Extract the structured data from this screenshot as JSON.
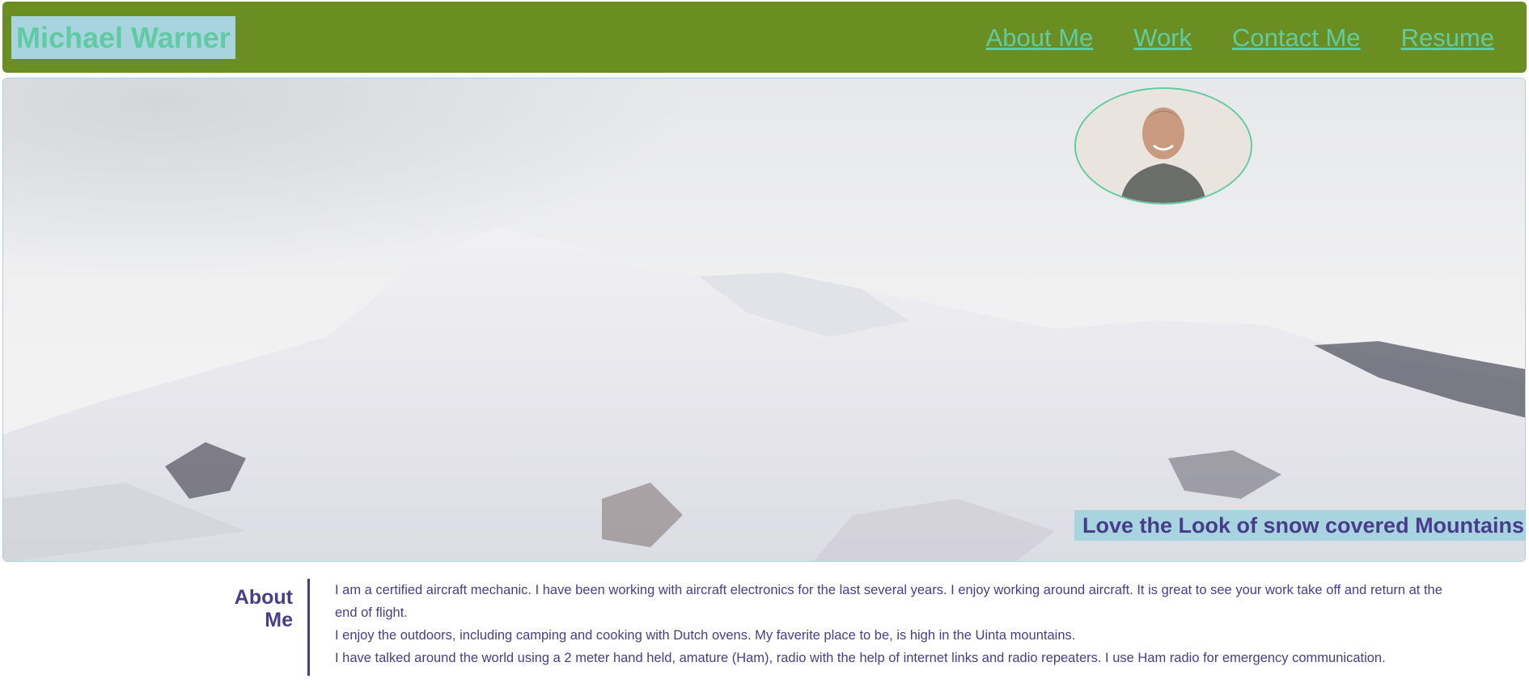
{
  "header": {
    "brand": "Michael Warner",
    "nav": [
      "About Me",
      "Work",
      "Contact Me",
      "Resume"
    ]
  },
  "hero": {
    "caption": "Love the Look of snow covered Mountains!",
    "portrait_icon": "person-photo-icon"
  },
  "about": {
    "heading_line1": "About",
    "heading_line2": "Me",
    "paragraphs": [
      "I am a certified aircraft mechanic. I have been working with aircraft electronics for the last several years. I enjoy working around aircraft. It is great to see your work take off and return at the end of flight.",
      "I enjoy the outdoors, including camping and cooking with Dutch ovens. My faverite place to be, is high in the Uinta mountains.",
      "I have talked around the world using a 2 meter hand held, amature (Ham), radio with the help of internet links and radio repeaters. I use Ham radio for emergency communication."
    ]
  },
  "colors": {
    "header_bg": "#6b8e23",
    "accent": "#5fcba3",
    "highlight_bg": "#a8d4e0",
    "text": "#483d8b"
  }
}
